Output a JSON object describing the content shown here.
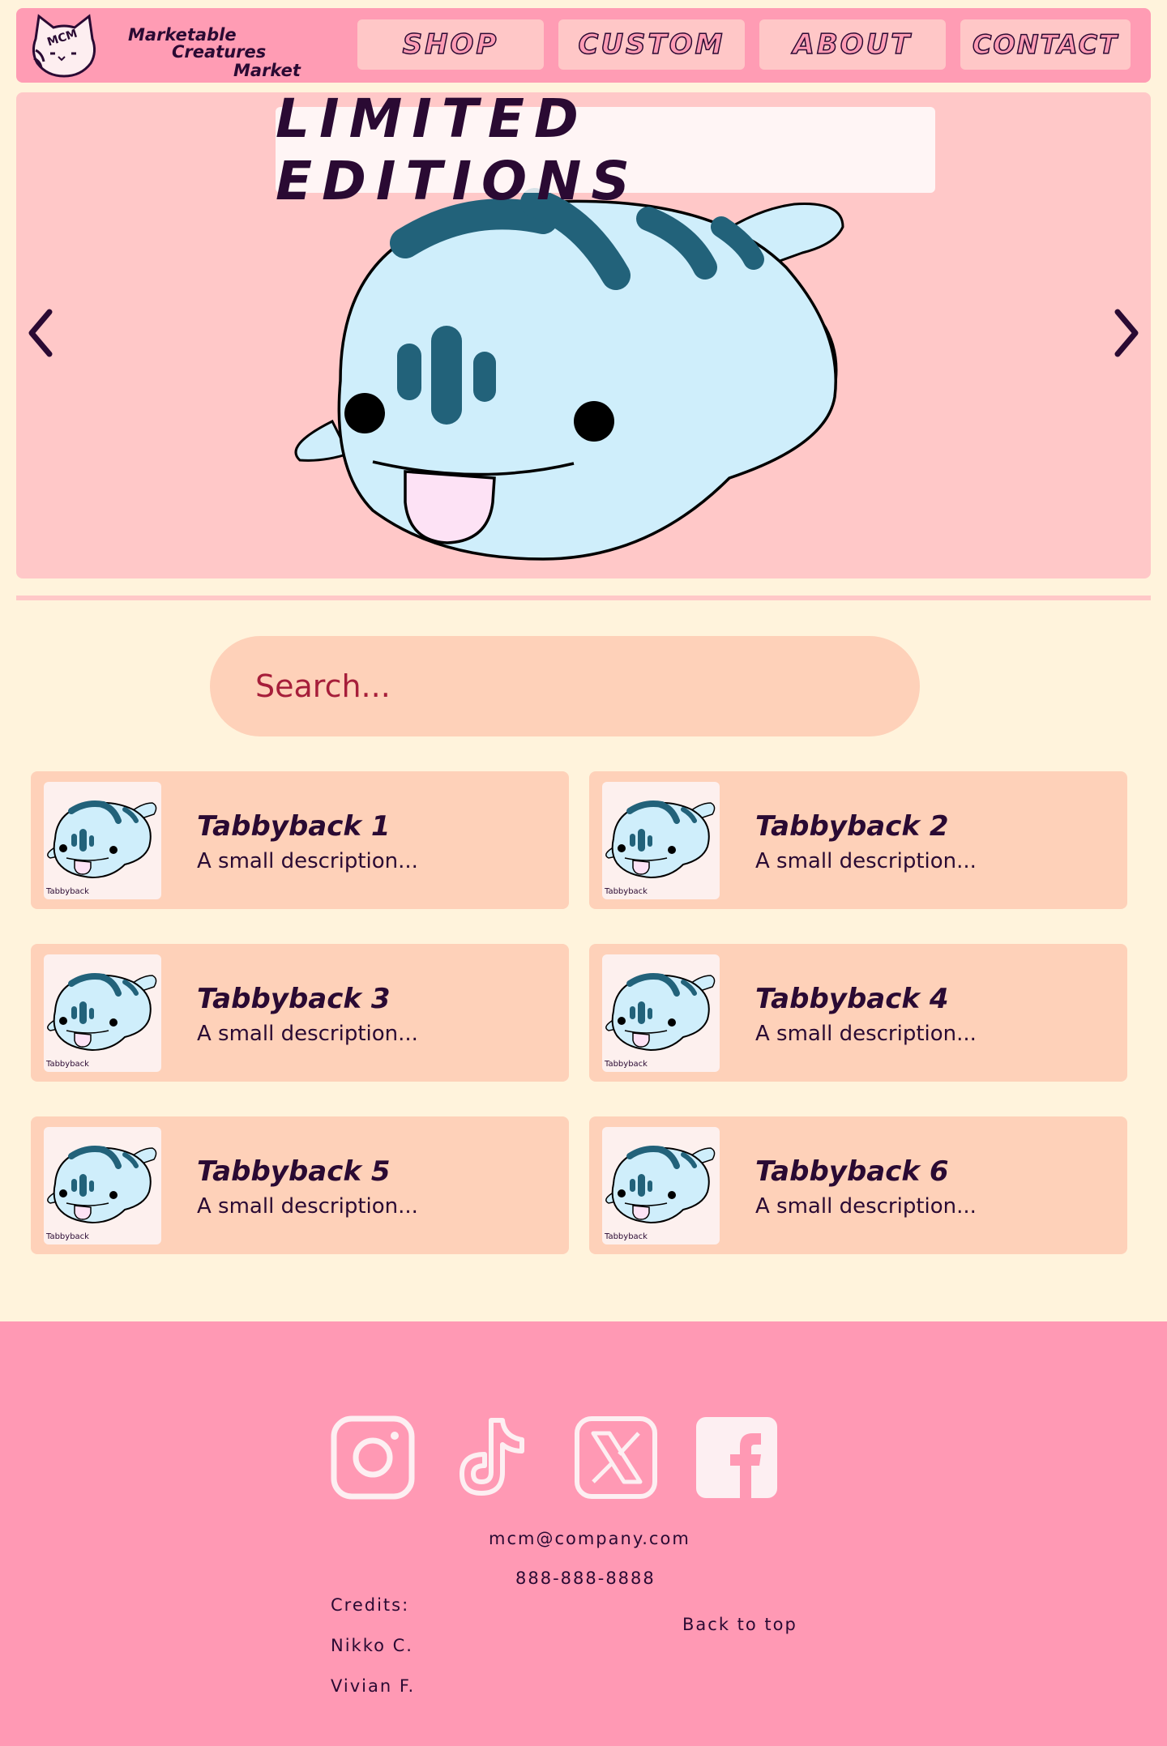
{
  "brand": {
    "logo_text": "MCM",
    "line1": "Marketable",
    "line2": "Creatures",
    "line3": "Market"
  },
  "nav": {
    "shop": "SHOP",
    "custom": "CUSTOM",
    "about": "ABOUT",
    "contact": "CONTACT"
  },
  "hero": {
    "title": "LIMITED EDITIONS",
    "prev_icon": "chevron-left-icon",
    "next_icon": "chevron-right-icon"
  },
  "search": {
    "placeholder": "Search..."
  },
  "products": [
    {
      "name": "Tabbyback 1",
      "description": "A small description...",
      "thumb_caption": "Tabbyback"
    },
    {
      "name": "Tabbyback 2",
      "description": "A small description...",
      "thumb_caption": "Tabbyback"
    },
    {
      "name": "Tabbyback 3",
      "description": "A small description...",
      "thumb_caption": "Tabbyback"
    },
    {
      "name": "Tabbyback 4",
      "description": "A small description...",
      "thumb_caption": "Tabbyback"
    },
    {
      "name": "Tabbyback 5",
      "description": "A small description...",
      "thumb_caption": "Tabbyback"
    },
    {
      "name": "Tabbyback 6",
      "description": "A small description...",
      "thumb_caption": "Tabbyback"
    }
  ],
  "footer": {
    "social": [
      "instagram-icon",
      "tiktok-icon",
      "x-icon",
      "facebook-icon"
    ],
    "email": "mcm@company.com",
    "phone": "888-888-8888",
    "credits_label": "Credits:",
    "credits": [
      "Nikko C.",
      "Vivian F."
    ],
    "back_to_top": "Back to top"
  },
  "colors": {
    "page_bg": "#fff3dc",
    "nav_bg": "#ff9cb4",
    "nav_button_bg": "#ffc7c7",
    "hero_bg": "#ffc8c8",
    "card_bg": "#fed1b9",
    "footer_bg": "#ff99b4",
    "text_dark": "#2a0a33",
    "search_text": "#a61e3a",
    "creature_body": "#cfeefb",
    "creature_stripes": "#22627a"
  }
}
